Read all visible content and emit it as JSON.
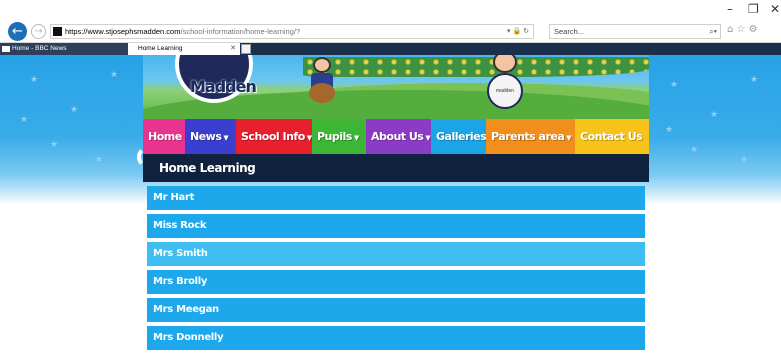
{
  "browser": {
    "url_host": "https://www.stjosephsmadden.com",
    "url_path": "/school-information/home-learning/?",
    "search_placeholder": "Search...",
    "tabs": [
      {
        "label": "Home - BBC News"
      },
      {
        "label": "Home Learning"
      }
    ]
  },
  "site": {
    "logo_text": "Madden",
    "drum_text": "madden",
    "menu": [
      {
        "label": "Home",
        "dropdown": false,
        "color": "#e8348e"
      },
      {
        "label": "News",
        "dropdown": true,
        "color": "#3a3fd0"
      },
      {
        "label": "School Info",
        "dropdown": true,
        "color": "#e81f2d"
      },
      {
        "label": "Pupils",
        "dropdown": true,
        "color": "#3db535"
      },
      {
        "label": "About Us",
        "dropdown": true,
        "color": "#8c3bc4"
      },
      {
        "label": "Galleries",
        "dropdown": false,
        "color": "#1aa6e6"
      },
      {
        "label": "Parents area",
        "dropdown": true,
        "color": "#f18e1c"
      },
      {
        "label": "Contact Us",
        "dropdown": false,
        "color": "#f7c31a"
      }
    ],
    "page_title": "Home Learning",
    "teachers": [
      {
        "label": "Mr Hart"
      },
      {
        "label": "Miss Rock"
      },
      {
        "label": "Mrs Smith"
      },
      {
        "label": "Mrs Brolly"
      },
      {
        "label": "Mrs Meegan"
      },
      {
        "label": "Mrs Donnelly"
      }
    ]
  },
  "colors": {
    "row_blue": "#1ca8ea",
    "row_hover": "#3fbcf0",
    "title_bar": "#10223d"
  }
}
